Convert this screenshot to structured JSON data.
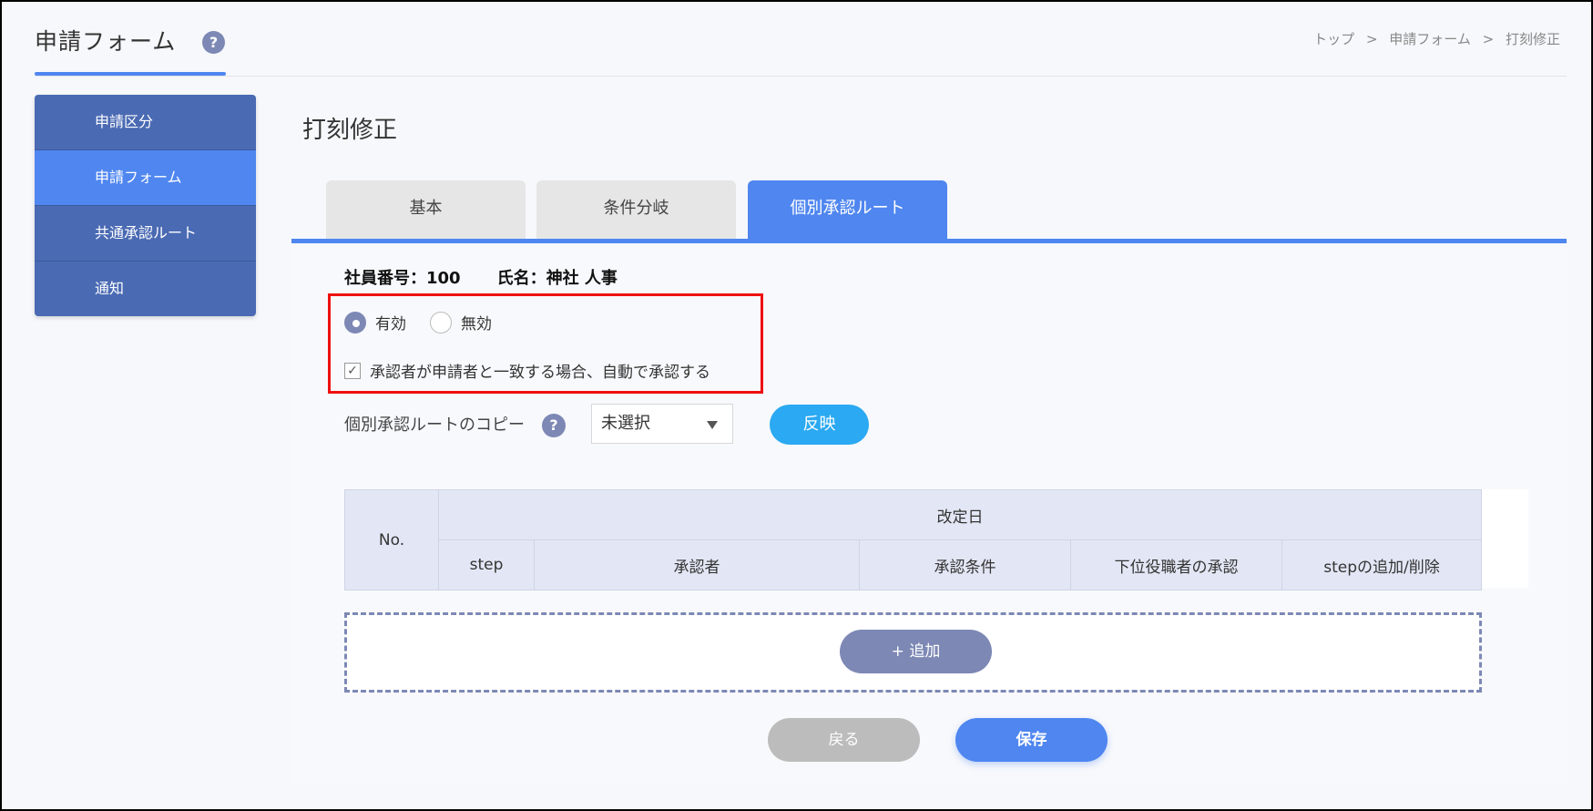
{
  "header": {
    "app_title": "申請フォーム",
    "help_glyph": "?",
    "breadcrumb": [
      "トップ",
      "申請フォーム",
      "打刻修正"
    ],
    "breadcrumb_sep": ">"
  },
  "sidebar": {
    "items": [
      {
        "label": "申請区分"
      },
      {
        "label": "申請フォーム"
      },
      {
        "label": "共通承認ルート"
      },
      {
        "label": "通知"
      }
    ],
    "active_index": 1
  },
  "page": {
    "title": "打刻修正"
  },
  "tabs": [
    {
      "label": "基本"
    },
    {
      "label": "条件分岐"
    },
    {
      "label": "個別承認ルート"
    }
  ],
  "employee": {
    "number_label": "社員番号：100",
    "name_label": "氏名：神社 人事"
  },
  "status": {
    "enabled_label": "有効",
    "disabled_label": "無効",
    "selected": "有効"
  },
  "auto_approve": {
    "label": "承認者が申請者と一致する場合、自動で承認する",
    "checked": true,
    "check_glyph": "✓"
  },
  "copy": {
    "label": "個別承認ルートのコピー",
    "help_glyph": "?",
    "select_value": "未選択",
    "apply_button": "反映"
  },
  "table": {
    "no_header": "No.",
    "group_header": "改定日",
    "columns": [
      "step",
      "承認者",
      "承認条件",
      "下位役職者の承認",
      "stepの追加/削除"
    ]
  },
  "actions": {
    "add_button": "+  追加",
    "back_button": "戻る",
    "save_button": "保存"
  },
  "colors": {
    "accent": "#4f86f0",
    "sidebar": "#4a6ab3",
    "help": "#7d88b5",
    "apply": "#2ba9f2",
    "highlight": "#e11111"
  }
}
